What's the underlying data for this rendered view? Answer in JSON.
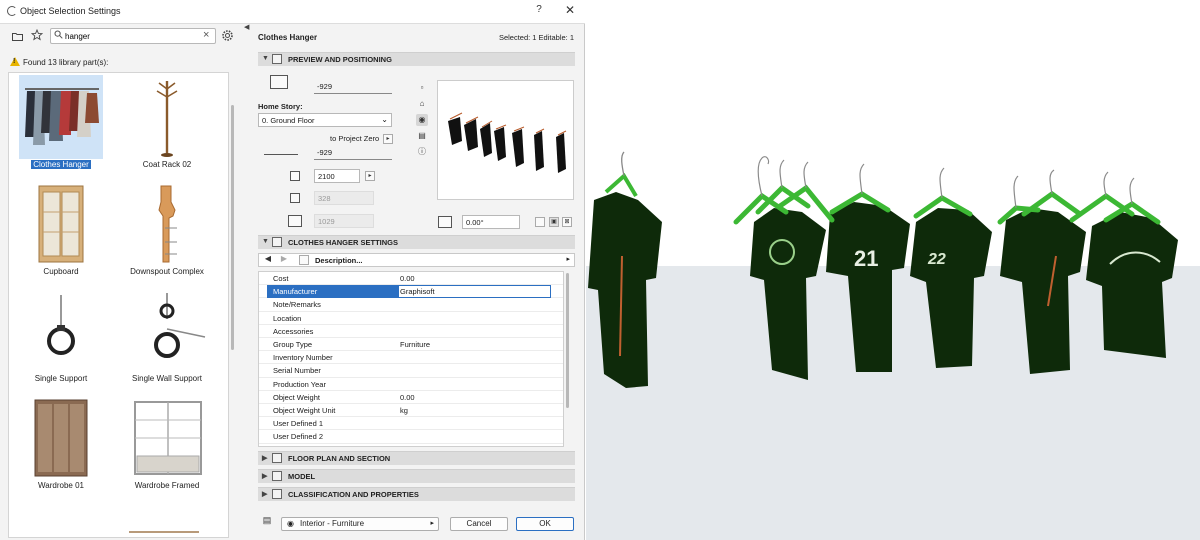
{
  "window": {
    "title": "Object Selection Settings",
    "help": "?",
    "close": "✕"
  },
  "library": {
    "search": {
      "value": "hanger",
      "placeholder": ""
    },
    "found_text": "Found 13 library part(s):",
    "items": [
      {
        "label": "Clothes Hanger",
        "selected": true
      },
      {
        "label": "Coat Rack 02",
        "selected": false
      },
      {
        "label": "Cupboard",
        "selected": false
      },
      {
        "label": "Downspout Complex",
        "selected": false
      },
      {
        "label": "Single Support",
        "selected": false
      },
      {
        "label": "Single Wall Support",
        "selected": false
      },
      {
        "label": "Wardrobe 01",
        "selected": false
      },
      {
        "label": "Wardrobe Framed",
        "selected": false
      }
    ]
  },
  "header": {
    "object_name": "Clothes Hanger",
    "selection_info": "Selected: 1 Editable: 1"
  },
  "sections": {
    "preview": "PREVIEW AND POSITIONING",
    "settings": "CLOTHES HANGER SETTINGS",
    "floorplan": "FLOOR PLAN AND SECTION",
    "model": "MODEL",
    "classification": "CLASSIFICATION AND PROPERTIES"
  },
  "positioning": {
    "elevation_top": "-929",
    "home_story_label": "Home Story:",
    "home_story_value": "0. Ground Floor",
    "to_project_zero": "to Project Zero",
    "elevation_zero": "-929",
    "height": "2100",
    "width": "328",
    "depth": "1029",
    "angle": "0.00°"
  },
  "description": {
    "label": "Description..."
  },
  "parameters": [
    {
      "name": "Cost",
      "value": "0.00"
    },
    {
      "name": "Manufacturer",
      "value": "Graphisoft",
      "selected": true
    },
    {
      "name": "Note/Remarks",
      "value": ""
    },
    {
      "name": "Location",
      "value": ""
    },
    {
      "name": "Accessories",
      "value": ""
    },
    {
      "name": "Group Type",
      "value": "Furniture"
    },
    {
      "name": "Inventory Number",
      "value": ""
    },
    {
      "name": "Serial Number",
      "value": ""
    },
    {
      "name": "Production Year",
      "value": ""
    },
    {
      "name": "Object Weight",
      "value": "0.00"
    },
    {
      "name": "Object Weight Unit",
      "value": "kg"
    },
    {
      "name": "User Defined 1",
      "value": ""
    },
    {
      "name": "User Defined 2",
      "value": ""
    }
  ],
  "footer": {
    "layer": "Interior - Furniture",
    "cancel": "Cancel",
    "ok": "OK"
  },
  "colors": {
    "accent": "#2b6fc2",
    "shirt": "#0e2a0a",
    "hanger": "#3cb834",
    "floor": "#e4e8ec"
  }
}
